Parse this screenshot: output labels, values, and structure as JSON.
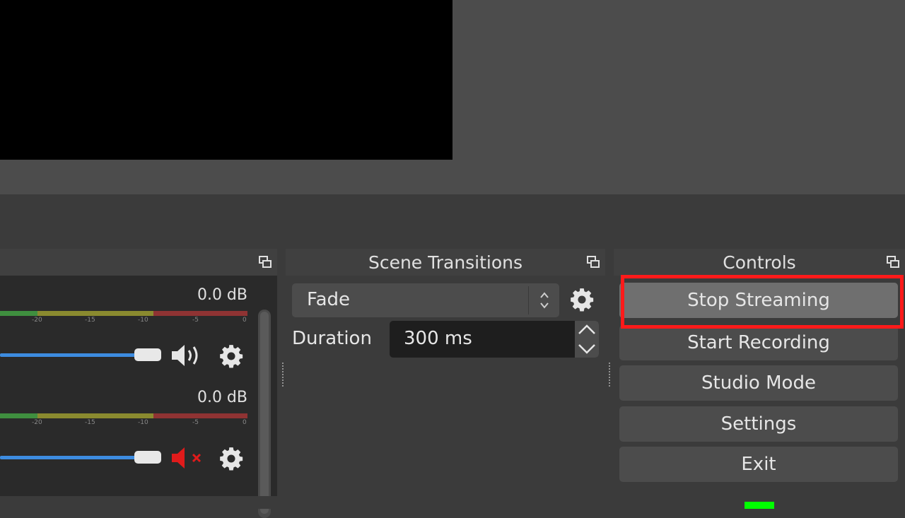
{
  "mixer": {
    "channels": [
      {
        "db": "0.0 dB",
        "muted": false,
        "ticks": [
          "-20",
          "-15",
          "-10",
          "-5",
          "0"
        ]
      },
      {
        "db": "0.0 dB",
        "muted": true,
        "ticks": [
          "-20",
          "-15",
          "-10",
          "-5",
          "0"
        ]
      }
    ]
  },
  "transitions": {
    "title": "Scene Transitions",
    "selected": "Fade",
    "duration_label": "Duration",
    "duration_value": "300 ms"
  },
  "controls": {
    "title": "Controls",
    "buttons": [
      "Stop Streaming",
      "Start Recording",
      "Studio Mode",
      "Settings",
      "Exit"
    ]
  },
  "colors": {
    "highlight": "#ff1a1a",
    "fader": "#3d8ce0",
    "muted_icon": "#e01b1b",
    "status_green": "#00ff00"
  },
  "icons": {
    "undock": "undock-icon",
    "gear": "gear-icon",
    "speaker": "speaker-icon",
    "speaker_muted": "speaker-muted-icon"
  }
}
